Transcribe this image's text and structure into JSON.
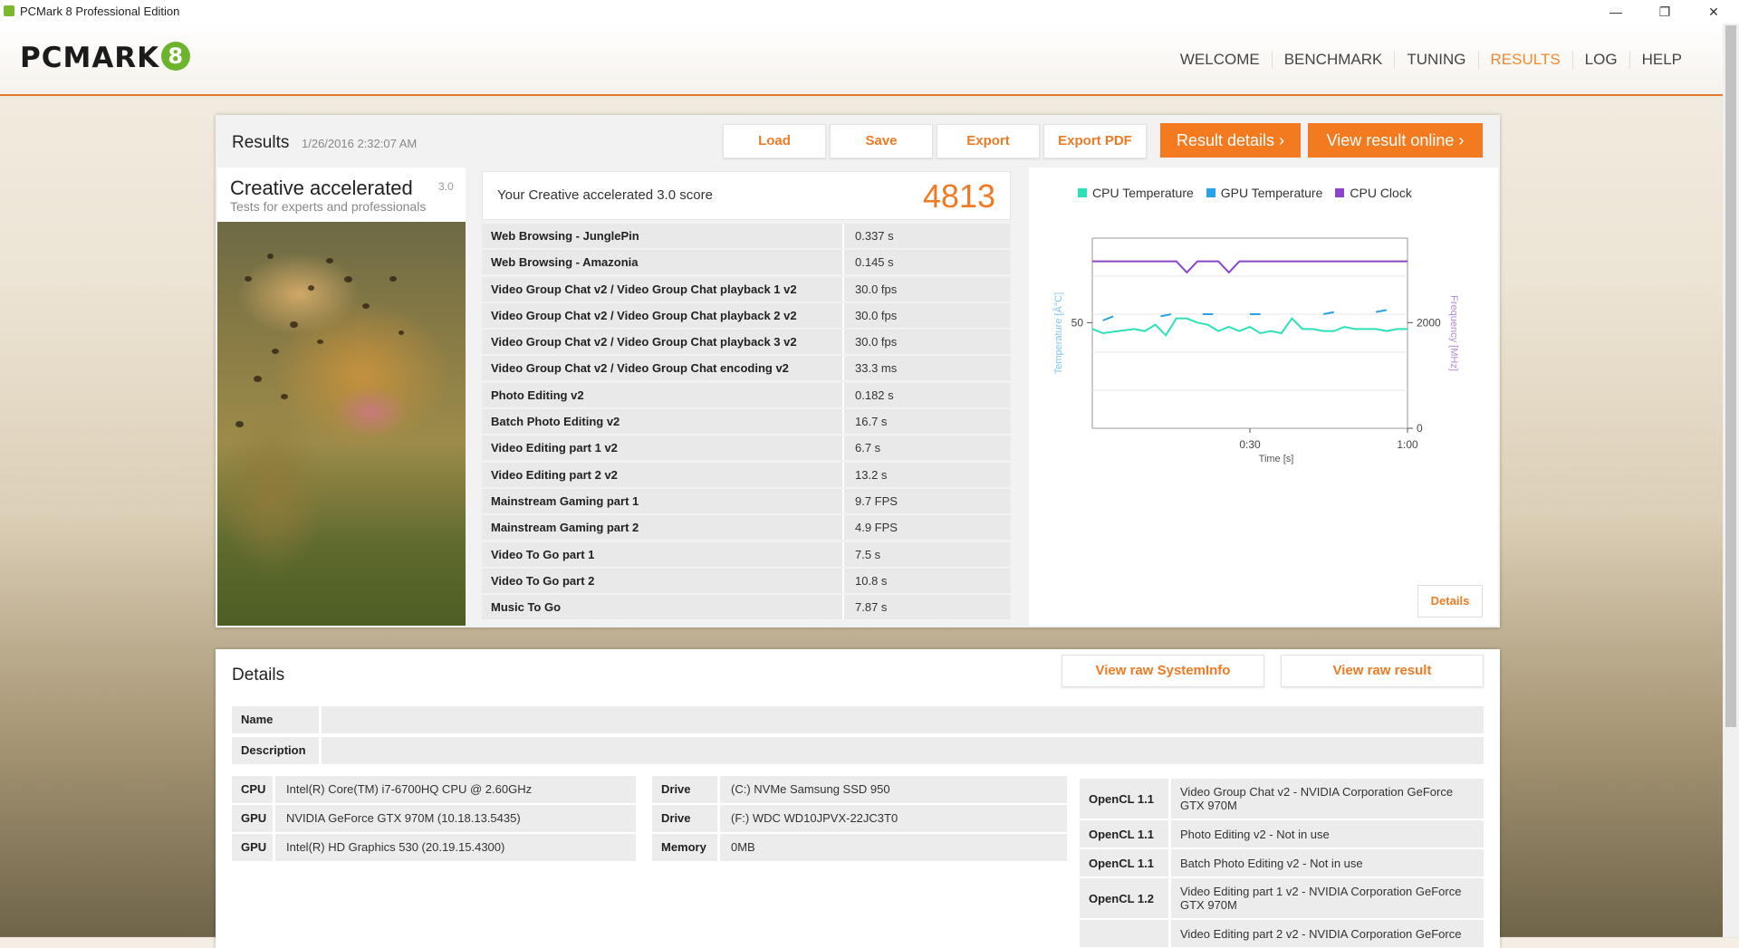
{
  "window": {
    "title": "PCMark 8 Professional Edition",
    "minimize": "—",
    "restore": "❐",
    "close": "✕"
  },
  "logo": {
    "text": "PCMARK",
    "num": "8"
  },
  "nav": {
    "items": [
      "WELCOME",
      "BENCHMARK",
      "TUNING",
      "RESULTS",
      "LOG",
      "HELP"
    ],
    "active": "RESULTS"
  },
  "results": {
    "title": "Results",
    "date": "1/26/2016 2:32:07 AM",
    "buttons": {
      "load": "Load",
      "save": "Save",
      "export": "Export",
      "export_pdf": "Export PDF",
      "result_details": "Result details",
      "view_online": "View result online"
    },
    "test": {
      "name": "Creative accelerated",
      "version": "3.0",
      "subtitle": "Tests for experts and professionals"
    },
    "score_label": "Your Creative accelerated 3.0 score",
    "score": "4813",
    "subtests": [
      {
        "name": "Web Browsing - JunglePin",
        "value": "0.337 s"
      },
      {
        "name": "Web Browsing - Amazonia",
        "value": "0.145 s"
      },
      {
        "name": "Video Group Chat v2 / Video Group Chat playback 1 v2",
        "value": "30.0 fps"
      },
      {
        "name": "Video Group Chat v2 / Video Group Chat playback 2 v2",
        "value": "30.0 fps"
      },
      {
        "name": "Video Group Chat v2 / Video Group Chat playback 3 v2",
        "value": "30.0 fps"
      },
      {
        "name": "Video Group Chat v2 / Video Group Chat encoding v2",
        "value": "33.3 ms"
      },
      {
        "name": "Photo Editing v2",
        "value": "0.182 s"
      },
      {
        "name": "Batch Photo Editing v2",
        "value": "16.7 s"
      },
      {
        "name": "Video Editing part 1 v2",
        "value": "6.7 s"
      },
      {
        "name": "Video Editing part 2 v2",
        "value": "13.2 s"
      },
      {
        "name": "Mainstream Gaming part 1",
        "value": "9.7 FPS"
      },
      {
        "name": "Mainstream Gaming part 2",
        "value": "4.9 FPS"
      },
      {
        "name": "Video To Go part 1",
        "value": "7.5 s"
      },
      {
        "name": "Video To Go part 2",
        "value": "10.8 s"
      },
      {
        "name": "Music To Go",
        "value": "7.87 s"
      }
    ],
    "details_button": "Details"
  },
  "chart_data": {
    "type": "line",
    "xlabel": "Time [s]",
    "ylabel_left": "Temperature [Â°C]",
    "ylabel_right": "Frequency [MHz]",
    "x_ticks": [
      "0:30",
      "1:00"
    ],
    "y_left_ticks": [
      "50"
    ],
    "y_right_ticks": [
      "2000",
      "0"
    ],
    "xlim": [
      0,
      60
    ],
    "ylim_left": [
      0,
      90
    ],
    "ylim_right": [
      0,
      3600
    ],
    "series": [
      {
        "name": "CPU Temperature",
        "color": "#2ee0b8",
        "x": [
          0,
          2,
          5,
          8,
          10,
          12,
          14,
          16,
          18,
          20,
          22,
          24,
          26,
          28,
          30,
          32,
          34,
          36,
          38,
          40,
          42,
          44,
          46,
          48,
          50,
          52,
          54,
          56,
          58,
          60
        ],
        "y": [
          47,
          45,
          46,
          47,
          46,
          49,
          44,
          52,
          52,
          50,
          49,
          46,
          48,
          46,
          48,
          45,
          46,
          45,
          52,
          47,
          47,
          46,
          46,
          48,
          47,
          47,
          47,
          46,
          47,
          47
        ]
      },
      {
        "name": "GPU Temperature",
        "color": "#29a3e6",
        "x": [
          2,
          4,
          13,
          15,
          21,
          23,
          30,
          32,
          44,
          46,
          54,
          56
        ],
        "y": [
          51,
          53,
          53,
          54,
          54,
          54,
          54,
          54,
          54,
          55,
          55,
          56
        ]
      },
      {
        "name": "CPU Clock",
        "color": "#8b44cc",
        "x": [
          0,
          10,
          14,
          16,
          18,
          20,
          24,
          26,
          28,
          30,
          40,
          50,
          60
        ],
        "y": [
          3160,
          3160,
          3160,
          3160,
          2950,
          3160,
          3160,
          2950,
          3160,
          3160,
          3160,
          3160,
          3160
        ]
      }
    ]
  },
  "details": {
    "title": "Details",
    "view_sysinfo": "View raw SystemInfo",
    "view_raw": "View raw result",
    "name_label": "Name",
    "name_value": "",
    "desc_label": "Description",
    "desc_value": "",
    "hardware": [
      {
        "k": "CPU",
        "v": "Intel(R) Core(TM) i7-6700HQ CPU @ 2.60GHz"
      },
      {
        "k": "GPU",
        "v": "NVIDIA GeForce GTX 970M (10.18.13.5435)"
      },
      {
        "k": "GPU",
        "v": "Intel(R) HD Graphics 530 (20.19.15.4300)"
      }
    ],
    "drives": [
      {
        "k": "Drive",
        "v": "(C:) NVMe Samsung SSD 950"
      },
      {
        "k": "Drive",
        "v": "(F:) WDC WD10JPVX-22JC3T0"
      },
      {
        "k": "Memory",
        "v": "0MB"
      }
    ],
    "opencl": [
      {
        "k": "OpenCL 1.1",
        "v": "Video Group Chat v2 - NVIDIA Corporation GeForce GTX 970M"
      },
      {
        "k": "OpenCL 1.1",
        "v": "Photo Editing v2 - Not in use"
      },
      {
        "k": "OpenCL 1.1",
        "v": "Batch Photo Editing v2 - Not in use"
      },
      {
        "k": "OpenCL 1.2",
        "v": "Video Editing part 1 v2 - NVIDIA Corporation GeForce GTX 970M"
      },
      {
        "k": "",
        "v": "Video Editing part 2 v2 - NVIDIA Corporation GeForce"
      }
    ]
  }
}
